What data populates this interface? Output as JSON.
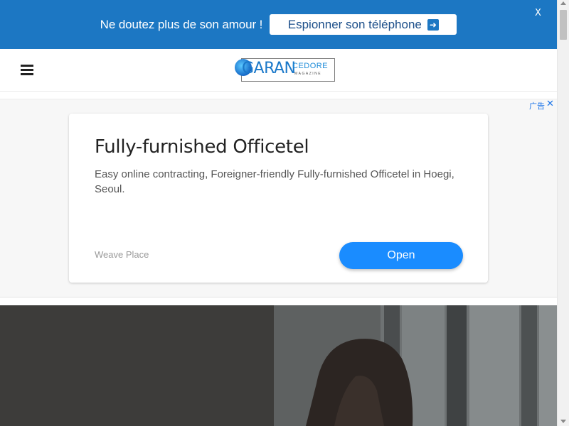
{
  "promo": {
    "text": "Ne doutez plus de son amour !",
    "button_label": "Espionner son téléphone",
    "button_icon": "arrow-right-icon",
    "close_label": "X",
    "background_color": "#1c77c3"
  },
  "header": {
    "menu_icon": "hamburger-menu-icon",
    "logo": {
      "main": "GARAN",
      "secondary": "CEDORE",
      "tagline": "MAGAZINE"
    }
  },
  "ad": {
    "choices_label": "广告",
    "close_label": "✕",
    "title": "Fully-furnished Officetel",
    "description": "Easy online contracting, Foreigner-friendly Fully-furnished Officetel in Hoegi, Seoul.",
    "advertiser": "Weave Place",
    "cta_label": "Open",
    "cta_color": "#1a8cff"
  },
  "hero": {
    "image_subject": "woman-by-window-photo"
  }
}
